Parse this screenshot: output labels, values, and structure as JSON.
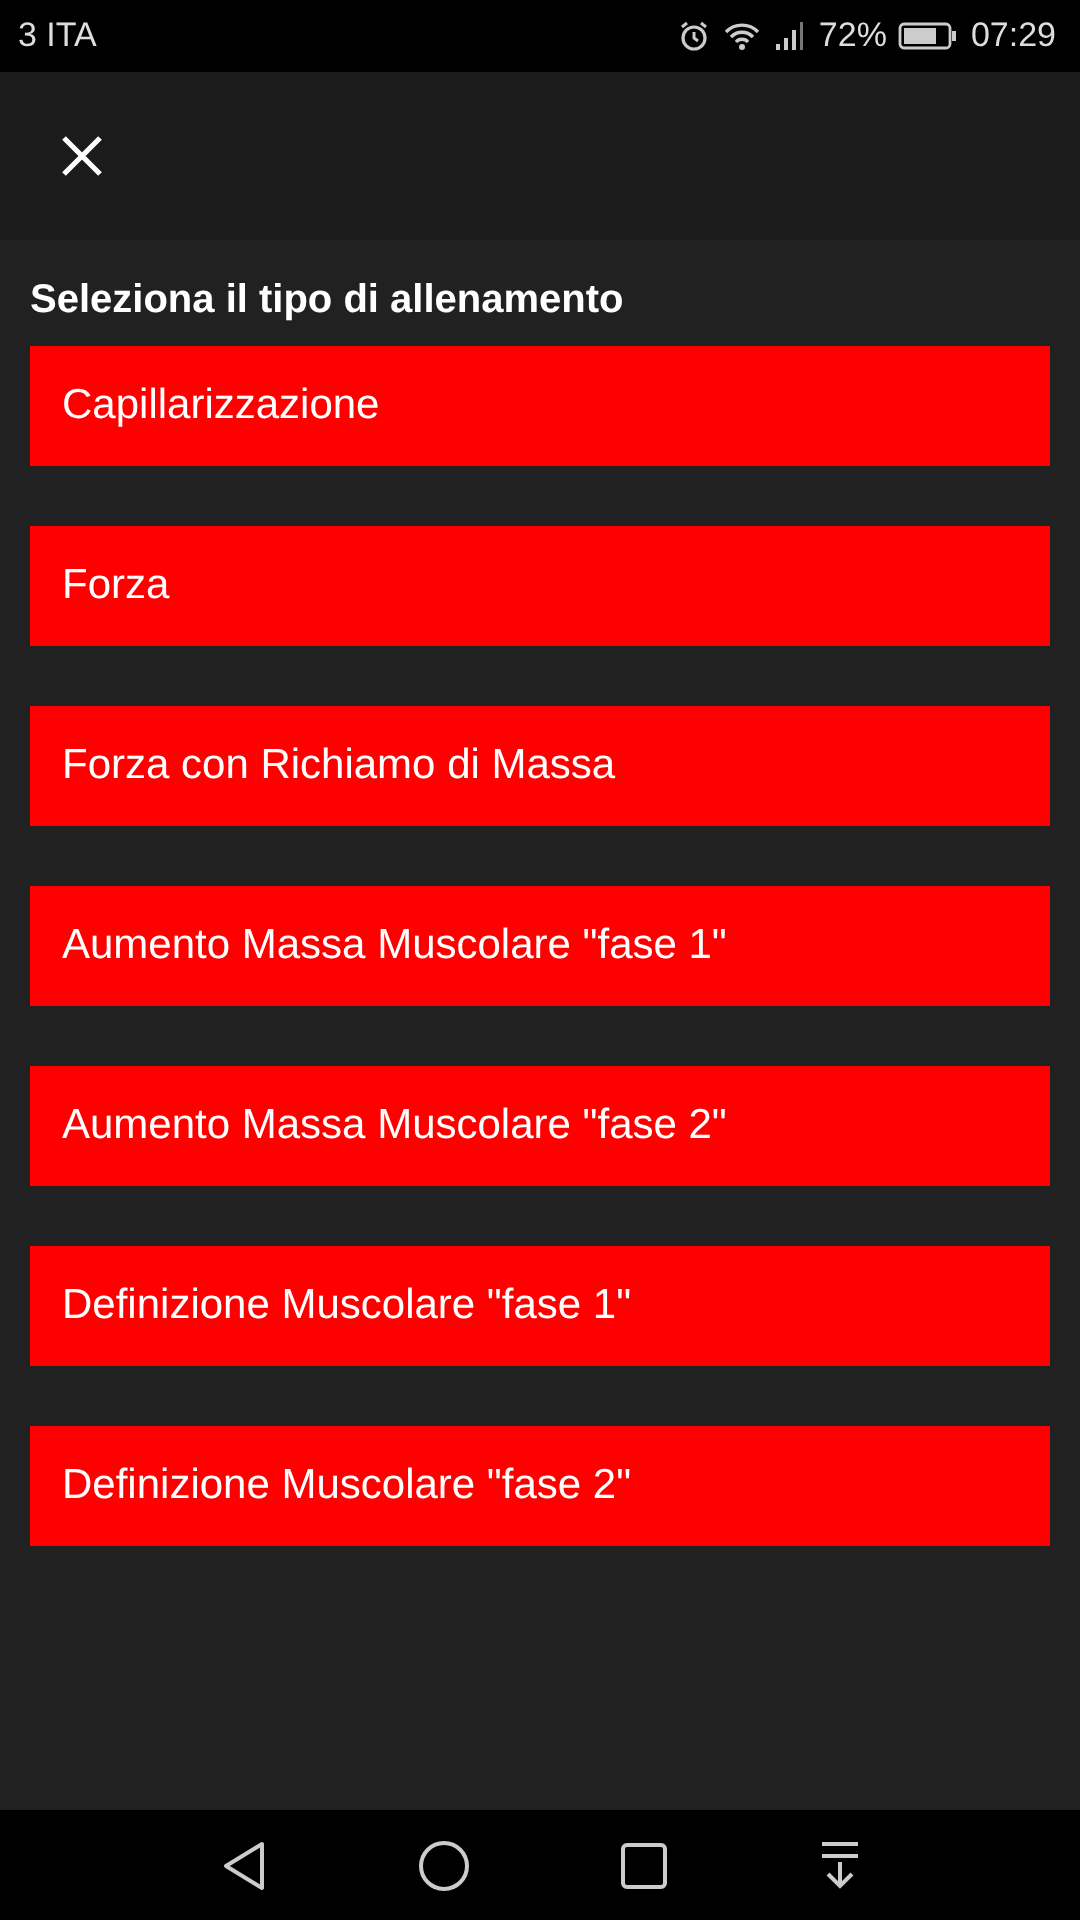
{
  "status_bar": {
    "carrier": "3 ITA",
    "battery_percent": "72%",
    "time": "07:29"
  },
  "title": "Seleziona il tipo di allenamento",
  "options": [
    {
      "label": "Capillarizzazione"
    },
    {
      "label": "Forza"
    },
    {
      "label": "Forza con Richiamo di Massa"
    },
    {
      "label": "Aumento Massa Muscolare \"fase 1\""
    },
    {
      "label": "Aumento Massa Muscolare \"fase 2\""
    },
    {
      "label": "Definizione Muscolare \"fase 1\""
    },
    {
      "label": "Definizione Muscolare \"fase 2\""
    }
  ]
}
